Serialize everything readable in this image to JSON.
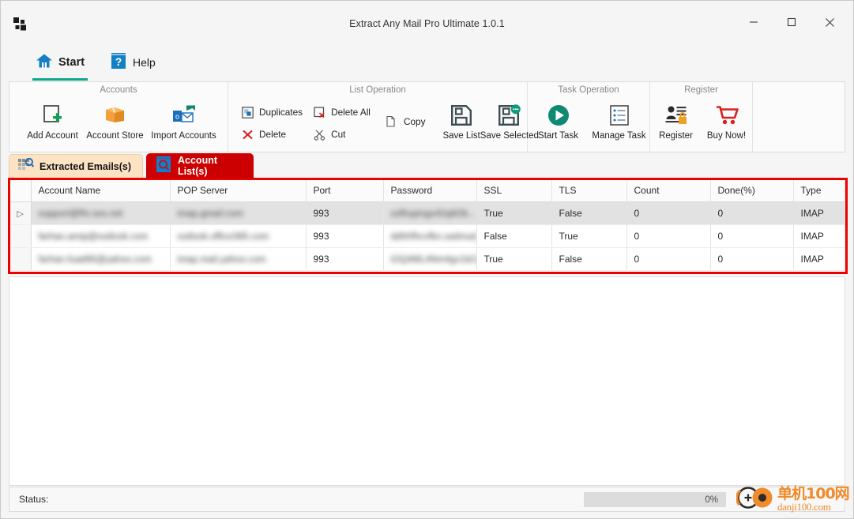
{
  "window": {
    "title": "Extract Any Mail Pro Ultimate 1.0.1",
    "logo_icon": "app-squares-icon",
    "controls": {
      "minimize_icon": "minimize-icon",
      "maximize_icon": "maximize-icon",
      "close_icon": "close-icon"
    }
  },
  "menubar": {
    "tabs": [
      {
        "label": "Start",
        "icon": "home-icon",
        "active": true
      },
      {
        "label": "Help",
        "icon": "question-book-icon",
        "active": false
      }
    ],
    "language": {
      "flag_icon": "flag-icon",
      "chevron_icon": "chevron-down-icon",
      "flag_color": "#009b88"
    }
  },
  "ribbon": {
    "groups": [
      {
        "title": "Accounts",
        "buttons": [
          {
            "label": "Add Account",
            "icon": "add-document-icon"
          },
          {
            "label": "Account Store",
            "icon": "orange-box-icon"
          },
          {
            "label": "Import Accounts",
            "icon": "outlook-import-icon"
          }
        ]
      },
      {
        "title": "List Operation",
        "small_buttons": [
          {
            "label": "Duplicates",
            "icon": "duplicates-icon"
          },
          {
            "label": "Delete",
            "icon": "red-x-icon"
          },
          {
            "label": "Delete All",
            "icon": "delete-all-icon"
          },
          {
            "label": "Cut",
            "icon": "scissors-icon"
          },
          {
            "label": "Copy",
            "icon": "copy-icon"
          }
        ],
        "buttons": [
          {
            "label": "Save List",
            "icon": "floppy-save-icon"
          },
          {
            "label": "Save Selected",
            "icon": "floppy-save-selected-icon"
          }
        ]
      },
      {
        "title": "Task Operation",
        "buttons": [
          {
            "label": "Start Task",
            "icon": "play-circle-icon"
          },
          {
            "label": "Manage Task",
            "icon": "list-document-icon"
          }
        ]
      },
      {
        "title": "Register",
        "buttons": [
          {
            "label": "Register",
            "icon": "user-card-lock-icon"
          },
          {
            "label": "Buy Now!",
            "icon": "shopping-cart-icon"
          }
        ]
      }
    ]
  },
  "content_tabs": [
    {
      "label": "Extracted Emails(s)",
      "icon": "grid-search-icon",
      "active": false
    },
    {
      "label": "Account List(s)",
      "icon": "magnifier-book-icon",
      "active": true
    }
  ],
  "accent_colors": {
    "active_tab": "#cc0000",
    "inactive_tab": "#fbe3c4",
    "annotation_border": "#ee0000",
    "start_underline": "#0fa88a",
    "watermark": "#f08a2a"
  },
  "table": {
    "columns": [
      "Account Name",
      "POP Server",
      "Port",
      "Password",
      "SSL",
      "TLS",
      "Count",
      "Done(%)",
      "Type"
    ],
    "row_marker_icon": "row-selector-arrow-icon",
    "rows": [
      {
        "selected": true,
        "marker": "▷",
        "account_name": "support@fhr.ses.net",
        "account_name_redacted": true,
        "pop_server": "imap.gmail.com",
        "pop_server_redacted": true,
        "port": "993",
        "password": "ssfhspings42q6Ok...",
        "password_redacted": true,
        "ssl": "True",
        "tls": "False",
        "count": "0",
        "done": "0",
        "type": "IMAP"
      },
      {
        "selected": false,
        "marker": "",
        "account_name": "farhan.amip@outlook.com",
        "account_name_redacted": true,
        "pop_server": "outlook.office365.com",
        "pop_server_redacted": true,
        "port": "993",
        "password": "ddhhfhcvfkn.uwtinud...",
        "password_redacted": true,
        "ssl": "False",
        "tls": "True",
        "count": "0",
        "done": "0",
        "type": "IMAP"
      },
      {
        "selected": false,
        "marker": "",
        "account_name": "farhan.fuad95@yahoo.com",
        "account_name_redacted": true,
        "pop_server": "imap.mail.yahoo.com",
        "pop_server_redacted": true,
        "port": "993",
        "password": "iOQ4ML4Nm4gv1bCq...",
        "password_redacted": true,
        "ssl": "True",
        "tls": "False",
        "count": "0",
        "done": "0",
        "type": "IMAP"
      }
    ]
  },
  "statusbar": {
    "label": "Status:",
    "progress_percent": "0%",
    "progress_value": 0
  },
  "watermark": {
    "cn": "单机100网",
    "en": "danji100.com",
    "logo_icon": "danji-logo-icon"
  }
}
